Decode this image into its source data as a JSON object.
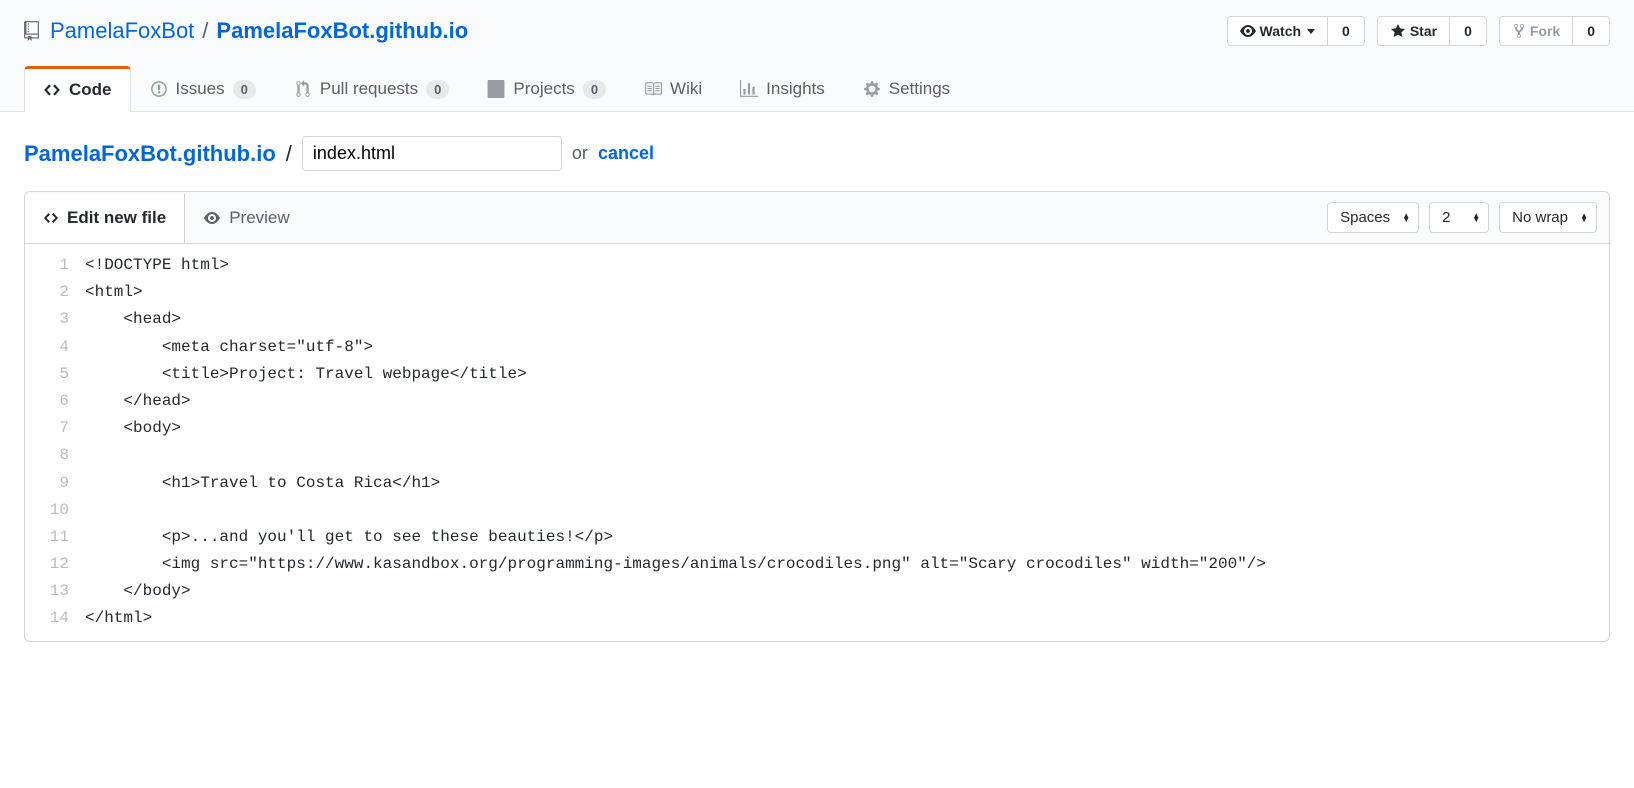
{
  "repo": {
    "owner": "PamelaFoxBot",
    "name": "PamelaFoxBot.github.io"
  },
  "actions": {
    "watch": {
      "label": "Watch",
      "count": "0"
    },
    "star": {
      "label": "Star",
      "count": "0"
    },
    "fork": {
      "label": "Fork",
      "count": "0"
    }
  },
  "tabs": [
    {
      "label": "Code",
      "icon": "code",
      "active": true
    },
    {
      "label": "Issues",
      "icon": "issues",
      "count": "0"
    },
    {
      "label": "Pull requests",
      "icon": "pr",
      "count": "0"
    },
    {
      "label": "Projects",
      "icon": "project",
      "count": "0"
    },
    {
      "label": "Wiki",
      "icon": "wiki"
    },
    {
      "label": "Insights",
      "icon": "insights"
    },
    {
      "label": "Settings",
      "icon": "settings"
    }
  ],
  "breadcrumb": {
    "repo": "PamelaFoxBot.github.io",
    "sep": "/",
    "filename": "index.html",
    "or": "or",
    "cancel": "cancel"
  },
  "editor": {
    "tabs": {
      "edit": "Edit new file",
      "preview": "Preview"
    },
    "controls": {
      "indent": "Spaces",
      "size": "2",
      "wrap": "No wrap"
    },
    "lines": [
      "<!DOCTYPE html>",
      "<html>",
      "    <head>",
      "        <meta charset=\"utf-8\">",
      "        <title>Project: Travel webpage</title>",
      "    </head>",
      "    <body>",
      "",
      "        <h1>Travel to Costa Rica</h1>",
      "",
      "        <p>...and you'll get to see these beauties!</p>",
      "        <img src=\"https://www.kasandbox.org/programming-images/animals/crocodiles.png\" alt=\"Scary crocodiles\" width=\"200\"/>",
      "    </body>",
      "</html>"
    ]
  }
}
